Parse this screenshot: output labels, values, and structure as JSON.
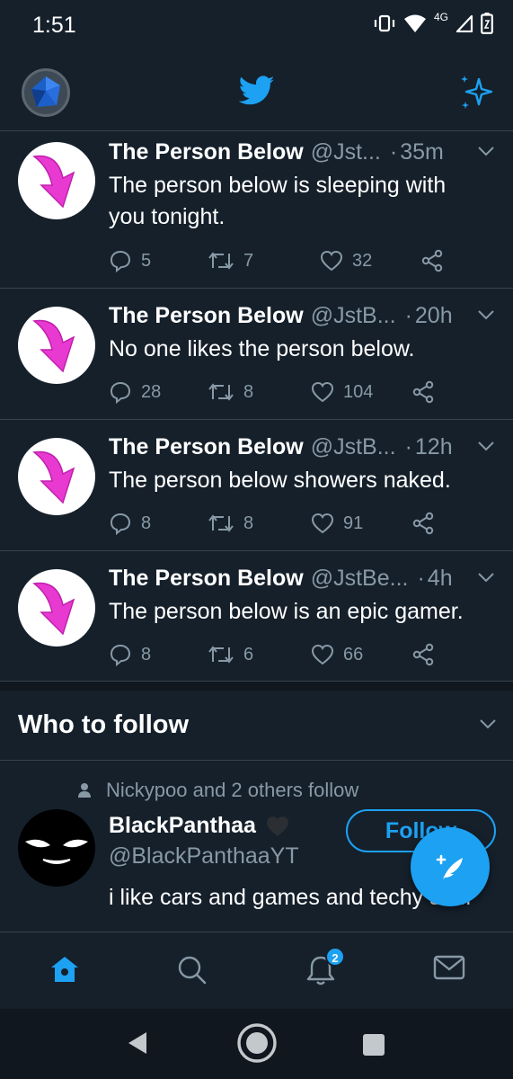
{
  "status": {
    "time": "1:51",
    "network_label": "4G"
  },
  "header": {
    "logo_icon": "twitter-bird-icon",
    "sparkle_icon": "sparkle-icon"
  },
  "tweets": [
    {
      "name": "The Person Below",
      "handle": "@Jst...",
      "time": "35m",
      "text": "The person below is sleeping with you tonight.",
      "replies": "5",
      "retweets": "7",
      "likes": "32"
    },
    {
      "name": "The Person Below",
      "handle": "@JstB...",
      "time": "20h",
      "text": "No one likes the person below.",
      "replies": "28",
      "retweets": "8",
      "likes": "104"
    },
    {
      "name": "The Person Below",
      "handle": "@JstB...",
      "time": "12h",
      "text": "The person below showers naked.",
      "replies": "8",
      "retweets": "8",
      "likes": "91"
    },
    {
      "name": "The Person Below",
      "handle": "@JstBe...",
      "time": "4h",
      "text": "The person below is an epic gamer.",
      "replies": "8",
      "retweets": "6",
      "likes": "66"
    }
  ],
  "who_to_follow": {
    "title": "Who to follow",
    "social_context": "Nickypoo and 2 others follow",
    "name": "BlackPanthaa",
    "handle": "@BlackPanthaaYT",
    "bio": "i like cars and games and techy stuff",
    "follow_label": "Follow"
  },
  "tabs": {
    "items": [
      "home-icon",
      "search-icon",
      "notifications-icon",
      "messages-icon"
    ],
    "notification_count": "2"
  },
  "colors": {
    "background": "#15202b",
    "accent": "#1da1f2",
    "muted": "#8899a6",
    "divider": "#38444d"
  }
}
